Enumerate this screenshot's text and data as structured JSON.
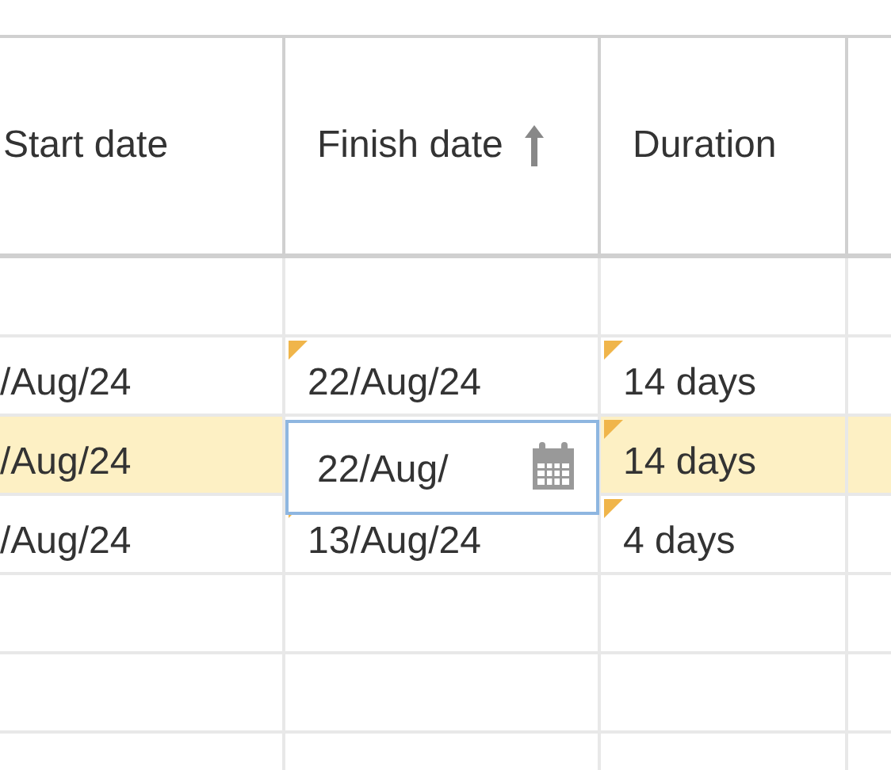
{
  "table": {
    "columns": [
      {
        "label": "Start date",
        "sorted": false
      },
      {
        "label": "Finish date",
        "sorted": true
      },
      {
        "label": "Duration",
        "sorted": false
      }
    ],
    "rows": [
      {
        "kind": "empty",
        "selected": false
      },
      {
        "kind": "task",
        "selected": false,
        "start": "/Aug/24",
        "finish": {
          "text": "22/Aug/24",
          "changed": true,
          "editing": false
        },
        "duration": {
          "text": "14 days",
          "changed": true
        }
      },
      {
        "kind": "task",
        "selected": true,
        "start": "/Aug/24",
        "finish": {
          "text": "22/Aug/",
          "editing": true
        },
        "duration": {
          "text": "14 days",
          "changed": true
        }
      },
      {
        "kind": "task",
        "selected": false,
        "start": "/Aug/24",
        "finish": {
          "text": "13/Aug/24",
          "changed": true,
          "editing": false
        },
        "duration": {
          "text": "4 days",
          "changed": true
        }
      },
      {
        "kind": "empty",
        "selected": false
      },
      {
        "kind": "empty",
        "selected": false
      },
      {
        "kind": "empty",
        "selected": false
      }
    ]
  }
}
